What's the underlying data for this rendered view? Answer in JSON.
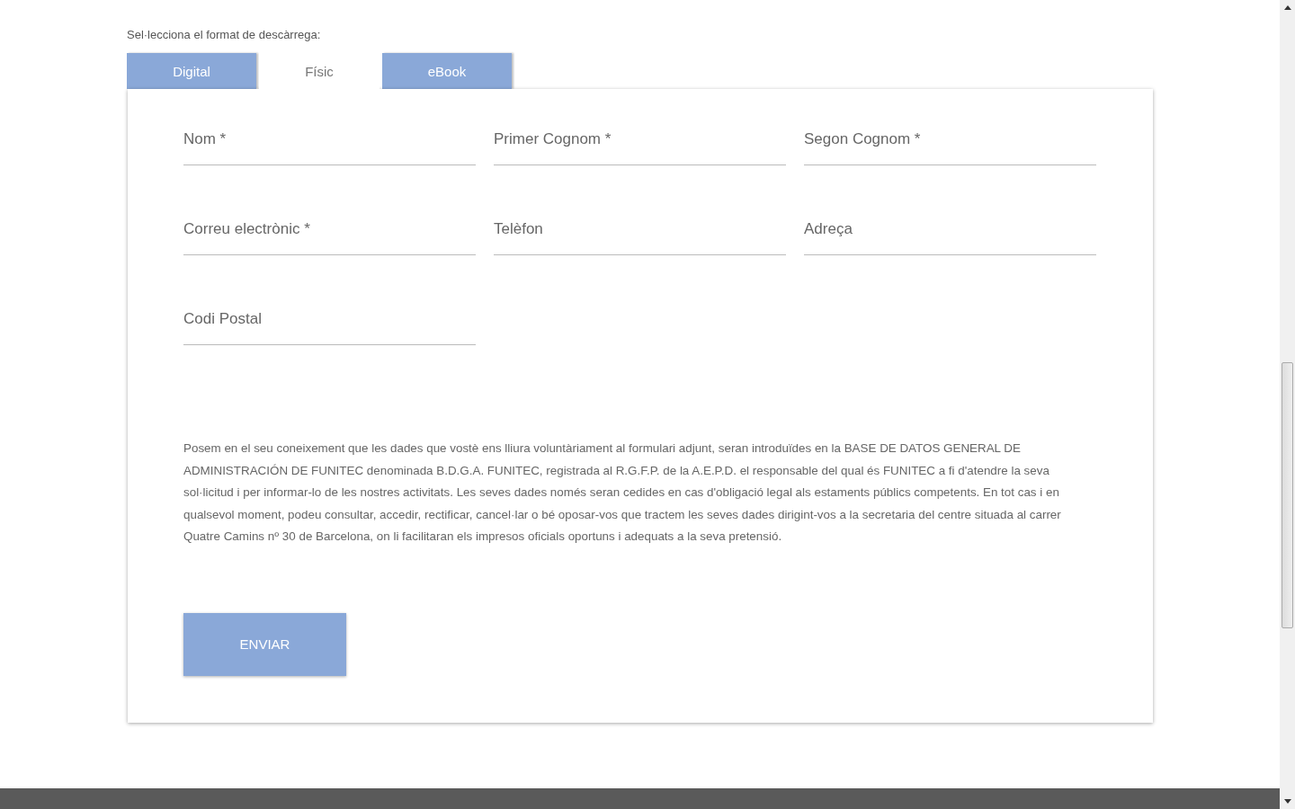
{
  "prompt": "Sel·lecciona el format de descàrrega:",
  "tabs": [
    {
      "label": "Digital",
      "selected": false
    },
    {
      "label": "Físic",
      "selected": true
    },
    {
      "label": "eBook",
      "selected": false
    }
  ],
  "fields": [
    {
      "label": "Nom *"
    },
    {
      "label": "Primer Cognom *"
    },
    {
      "label": "Segon Cognom *"
    },
    {
      "label": "Correu electrònic *"
    },
    {
      "label": "Telèfon"
    },
    {
      "label": "Adreça"
    },
    {
      "label": "Codi Postal"
    }
  ],
  "notice": "Posem en el seu coneixement que les dades que vostè ens lliura voluntàriament al formulari adjunt, seran introduïdes en la BASE DE DATOS GENERAL DE ADMINISTRACIÓN DE FUNITEC denominada B.D.G.A. FUNITEC, registrada al R.G.F.P. de la A.E.P.D. el responsable del qual és FUNITEC a fi d'atendre la seva sol·licitud i per informar-lo de les nostres activitats. Les seves dades només seran cedides en cas d'obligació legal als estaments públics competents. En tot cas i en qualsevol moment, podeu consultar, accedir, rectificar, cancel·lar o bé oposar-vos que tractem les seves dades dirigint-vos a la secretaria del centre situada al carrer Quatre Camins nº 30 de Barcelona, on li facilitaran els impresos oficials oportuns i adequats a la seva pretensió.",
  "submit": "ENVIAR"
}
